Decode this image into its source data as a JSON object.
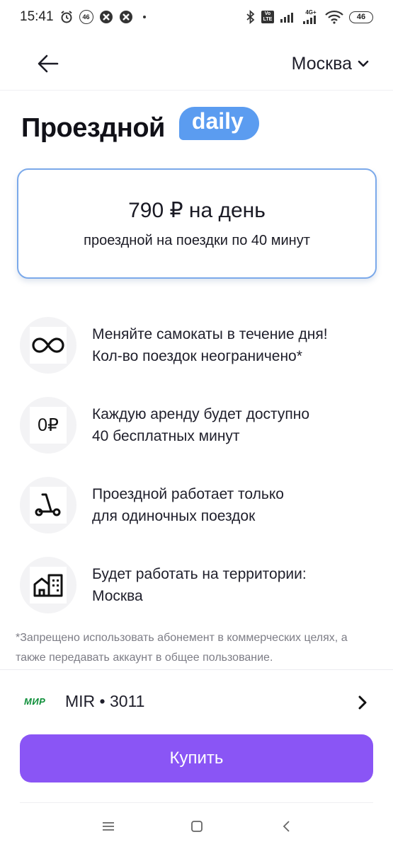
{
  "status_bar": {
    "time": "15:41",
    "notif_badge": "46",
    "volte_label": "Vo LTE",
    "network_label": "4G+",
    "battery": "46"
  },
  "header": {
    "city": "Москва"
  },
  "title": {
    "text": "Проездной",
    "badge": "daily"
  },
  "plan": {
    "price": "790 ₽ на день",
    "subtitle": "проездной на поездки по 40 минут"
  },
  "features": [
    {
      "icon": "infinity-icon",
      "line1": "Меняйте самокаты в течение дня!",
      "line2": "Кол-во поездок неограничено*"
    },
    {
      "icon": "zero-ruble-icon",
      "icon_text": "0₽",
      "line1": "Каждую аренду будет доступно",
      "line2": "40 бесплатных минут"
    },
    {
      "icon": "scooter-icon",
      "line1": "Проездной работает только",
      "line2": "для одиночных поездок"
    },
    {
      "icon": "city-buildings-icon",
      "line1": "Будет работать на территории:",
      "line2": "Москва"
    }
  ],
  "disclaimer": "*Запрещено использовать абонемент в коммерческих целях, а также передавать аккаунт в общее пользование.",
  "payment": {
    "logo_text": "МИР",
    "card": "MIR • 3011"
  },
  "buy_label": "Купить",
  "colors": {
    "accent": "#8a55f5",
    "badge": "#5b9cf0",
    "card_border": "#7ba9ea",
    "mir_green": "#0f8f3a"
  }
}
